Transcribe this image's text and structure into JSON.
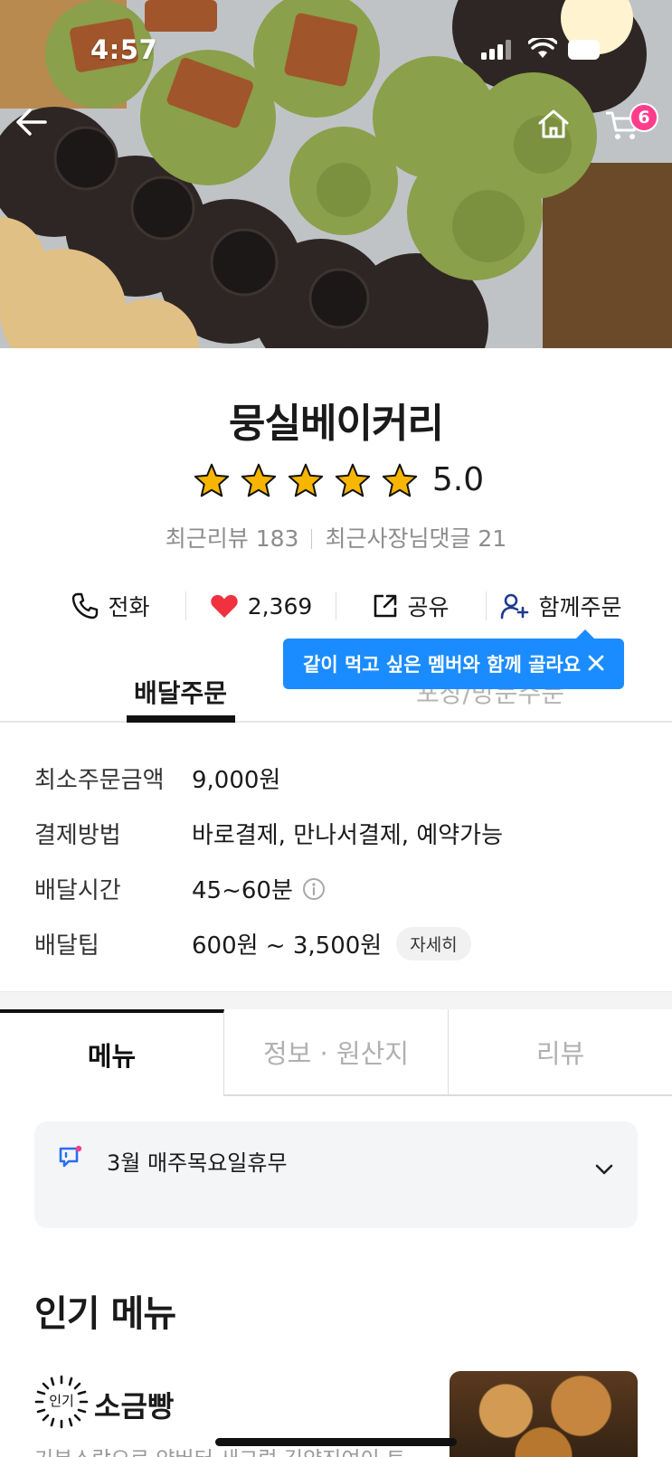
{
  "status_bar": {
    "time": "4:57"
  },
  "header": {
    "cart_count": "6",
    "icons": [
      "back-arrow-icon",
      "home-icon",
      "cart-icon"
    ]
  },
  "store": {
    "name": "뭉실베이커리",
    "rating": "5.0",
    "stars_filled": 5,
    "recent_reviews": "최근리뷰 183",
    "owner_comments": "최근사장님댓글 21"
  },
  "actions": {
    "call": "전화",
    "likes": "2,369",
    "share": "공유",
    "group_order": "함께주문"
  },
  "tooltip": {
    "text": "같이 먹고 싶은 멤버와 함께 골라요"
  },
  "order_tabs": {
    "delivery": "배달주문",
    "pickup": "포장/방문주문"
  },
  "info": {
    "rows": [
      {
        "key": "최소주문금액",
        "value": "9,000원"
      },
      {
        "key": "결제방법",
        "value": "바로결제, 만나서결제, 예약가능"
      },
      {
        "key": "배달시간",
        "value": "45~60분"
      },
      {
        "key": "배달팁",
        "value": "600원 ~ 3,500원"
      }
    ],
    "detail_chip": "자세히"
  },
  "menu_tabs": {
    "menu": "메뉴",
    "info": "정보 · 원산지",
    "review": "리뷰"
  },
  "notice": {
    "text": "3월 매주목요일휴무"
  },
  "popular": {
    "title": "인기 메뉴",
    "badge": "인기",
    "item_name": "소금빵",
    "item_desc": "기본스랍으로 양버터 새그럼 김약진여이 트"
  },
  "colors": {
    "accent_blue": "#1b8cff",
    "heart_red": "#f0313f",
    "badge_pink": "#ff3d8c",
    "star_yellow": "#f7b500"
  }
}
